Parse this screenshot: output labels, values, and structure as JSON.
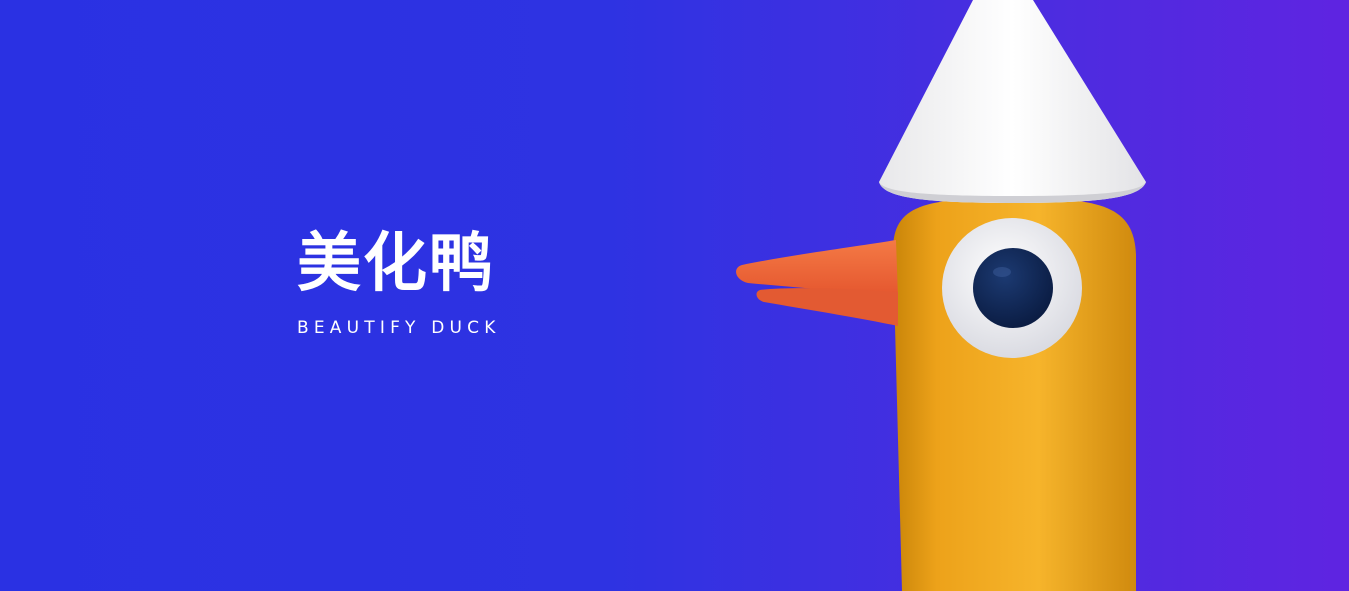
{
  "brand": {
    "name_cn": "美化鸭",
    "name_en": "BEAUTIFY DUCK"
  },
  "colors": {
    "background_start": "#2a31e3",
    "background_end": "#5f24e1",
    "duck_body": "#f0a41d",
    "beak": "#f2683a",
    "hat": "#ffffff",
    "pupil": "#0e2553"
  },
  "illustration": {
    "subject": "duck-mascot-icon",
    "parts": [
      "party-hat-icon",
      "beak-icon",
      "eye-icon"
    ]
  }
}
